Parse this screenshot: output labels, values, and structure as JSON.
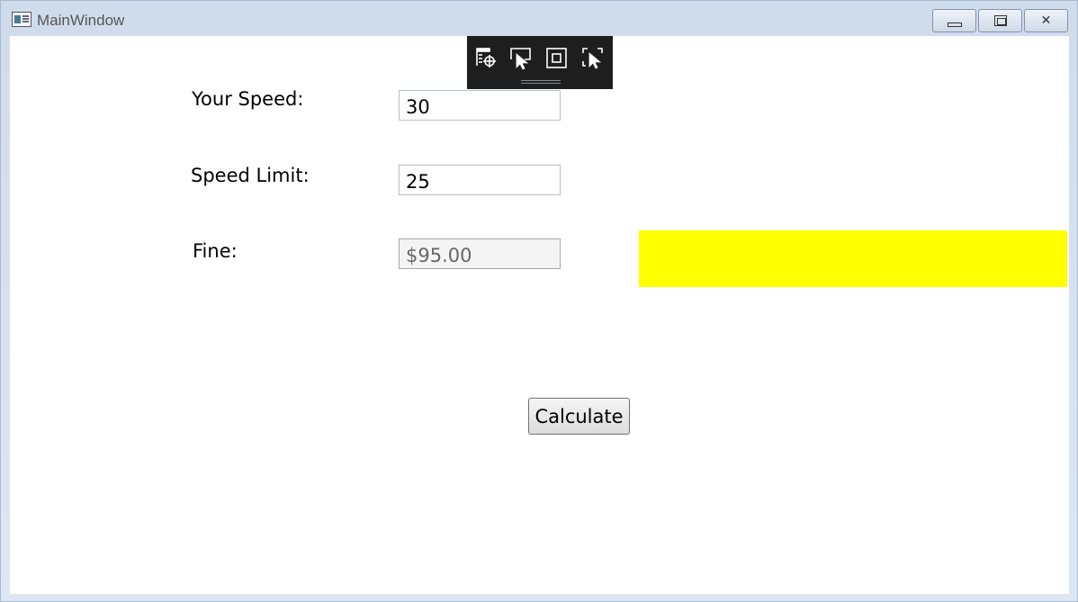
{
  "window": {
    "title": "MainWindow",
    "controls": {
      "minimize": "",
      "maximize": "",
      "close": "✕"
    }
  },
  "debug_toolbar": {
    "icons": [
      "live-visual-tree-icon",
      "select-element-icon",
      "display-layout-adorners-icon",
      "track-focused-element-icon"
    ]
  },
  "form": {
    "your_speed": {
      "label": "Your Speed:",
      "value": "30"
    },
    "speed_limit": {
      "label": "Speed Limit:",
      "value": "25"
    },
    "fine": {
      "label": "Fine:",
      "value": "$95.00"
    },
    "highlight_color": "#ffff00",
    "calculate_label": "Calculate"
  }
}
